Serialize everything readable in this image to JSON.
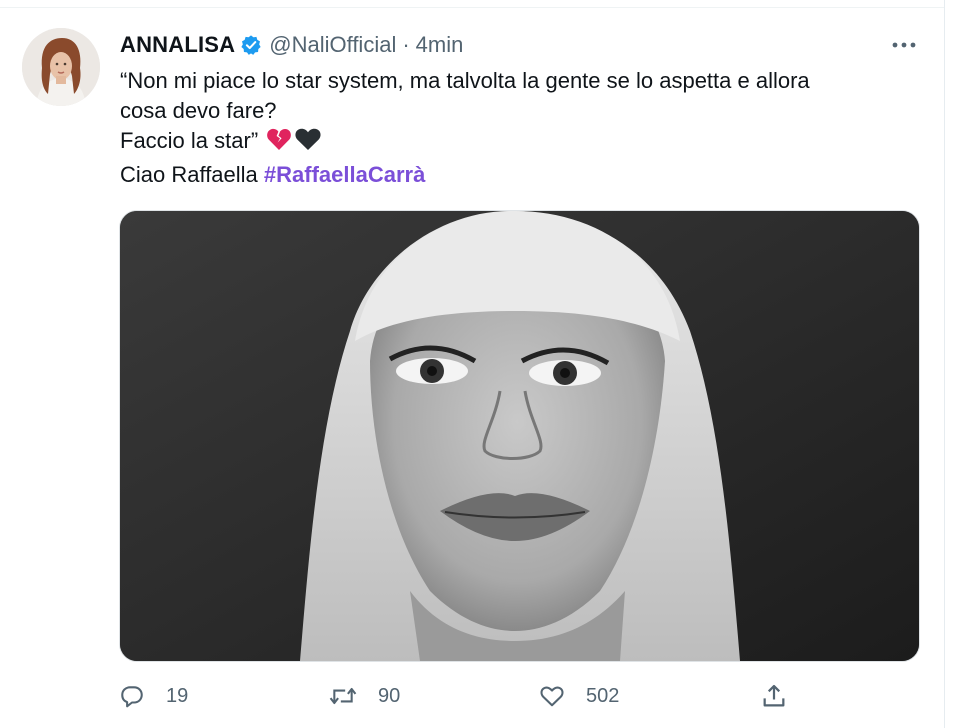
{
  "tweet": {
    "display_name": "ANNALISA",
    "handle": "@NaliOfficial",
    "separator": "·",
    "time": "4min",
    "text_lines": [
      "“Non mi piace lo star system, ma talvolta la gente se lo aspetta e allora",
      "cosa devo fare?",
      "Faccio la star”",
      "Ciao Raffaella"
    ],
    "hashtag": "#RaffaellaCarrà",
    "emojis": [
      "broken-heart-icon",
      "black-heart-icon"
    ]
  },
  "actions": {
    "reply_count": "19",
    "retweet_count": "90",
    "like_count": "502"
  },
  "colors": {
    "accent_hashtag": "#7b4fd8",
    "verified": "#1d9bf0",
    "muted_text": "#536471",
    "broken_heart": "#e0245e"
  }
}
